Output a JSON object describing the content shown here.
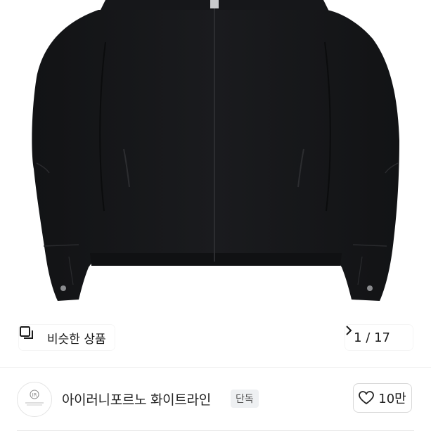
{
  "gallery": {
    "similar_label": "비슷한 상품",
    "similar_icon": "similar-items-icon",
    "current_page": "1",
    "total_pages": "17",
    "page_separator": " / ",
    "next_icon": "chevron-right-icon"
  },
  "shop": {
    "name": "아이러니포르노 화이트라인",
    "badge": "단독",
    "like_count": "10만",
    "like_icon": "heart-icon",
    "avatar_icon": "brand-logo"
  },
  "colors": {
    "jacket": "#151618",
    "background": "#ffffff",
    "badge_bg": "#eef0f2"
  }
}
